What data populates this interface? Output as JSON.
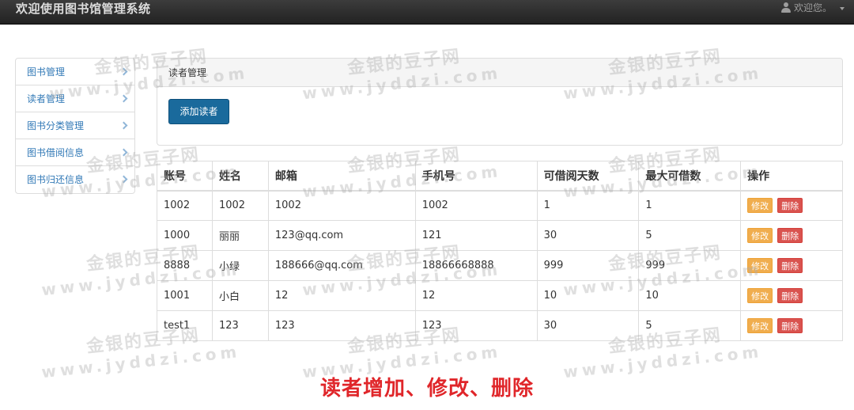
{
  "navbar": {
    "brand": "欢迎使用图书馆管理系统",
    "user_label": "欢迎您。"
  },
  "sidebar": {
    "items": [
      {
        "label": "图书管理"
      },
      {
        "label": "读者管理"
      },
      {
        "label": "图书分类管理"
      },
      {
        "label": "图书借阅信息"
      },
      {
        "label": "图书归还信息"
      }
    ]
  },
  "panel": {
    "title": "读者管理",
    "add_button": "添加读者"
  },
  "table": {
    "headers": [
      "账号",
      "姓名",
      "邮箱",
      "手机号",
      "可借阅天数",
      "最大可借数",
      "操作"
    ],
    "rows": [
      [
        "1002",
        "1002",
        "1002",
        "1002",
        "1",
        "1"
      ],
      [
        "1000",
        "丽丽",
        "123@qq.com",
        "121",
        "30",
        "5"
      ],
      [
        "8888",
        "小绿",
        "188666@qq.com",
        "18866668888",
        "999",
        "999"
      ],
      [
        "1001",
        "小白",
        "12",
        "12",
        "10",
        "10"
      ],
      [
        "test1",
        "123",
        "123",
        "123",
        "30",
        "5"
      ]
    ],
    "edit_label": "修改",
    "delete_label": "删除"
  },
  "watermark": {
    "line1": "金银的豆子网",
    "line2": "www.jyddzi.com"
  },
  "caption": "读者增加、修改、删除",
  "colors": {
    "navbar": "#222222",
    "primary_button": "#1a6a9c",
    "edit_button": "#f0ad4e",
    "delete_button": "#d9534f",
    "caption": "#e0262a",
    "link": "#337ab7"
  }
}
